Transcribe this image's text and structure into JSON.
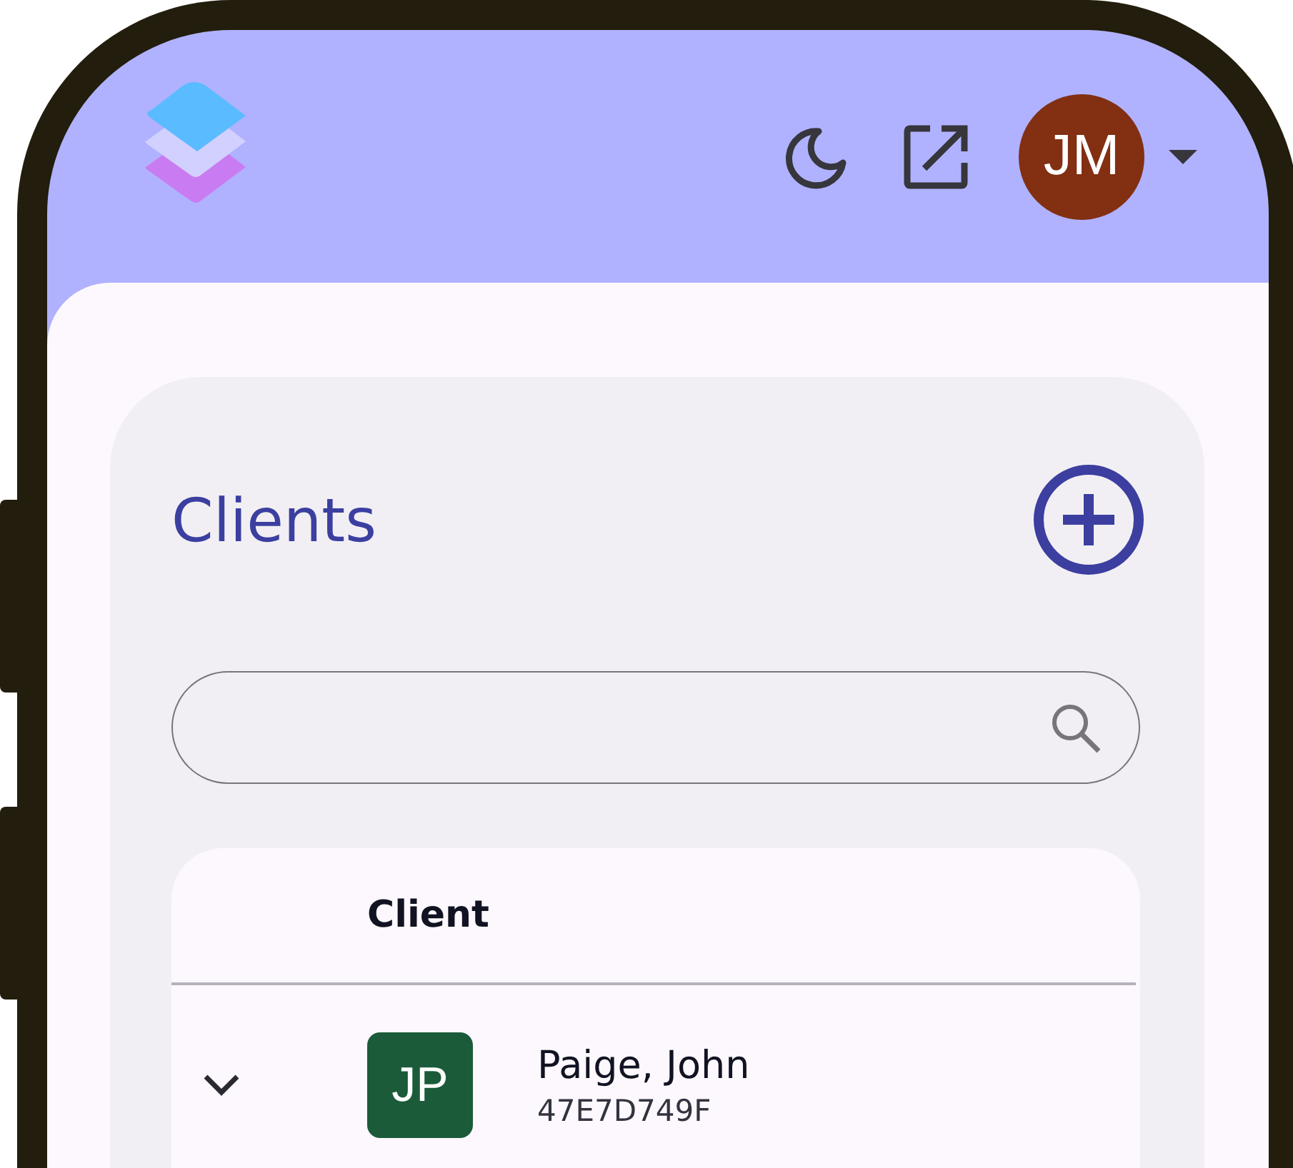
{
  "header": {
    "avatar_initials": "JM"
  },
  "panel": {
    "title": "Clients"
  },
  "table": {
    "columns": [
      "Client"
    ],
    "rows": [
      {
        "expanded": false,
        "initials": "JP",
        "name": "Paige, John",
        "id": "47E7D749F"
      }
    ]
  }
}
